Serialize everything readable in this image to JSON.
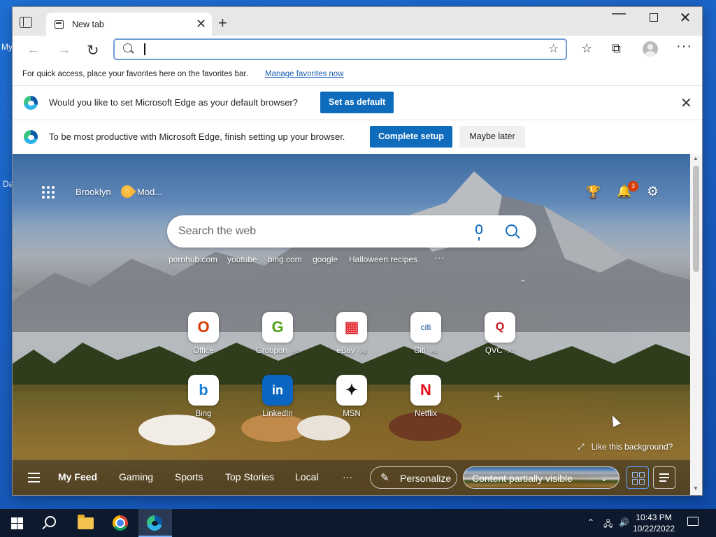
{
  "desktop": {
    "fragment1": "My",
    "fragment2": "Da"
  },
  "browser": {
    "tab_title": "New tab",
    "tab_close": "✕",
    "new_tab_symbol": "+",
    "address_value": "",
    "favbar_text": "For quick access, place your favorites here on the favorites bar.",
    "favbar_link": "Manage favorites now"
  },
  "infobars": {
    "default_prompt": "Would you like to set Microsoft Edge as your default browser?",
    "set_default_label": "Set as default",
    "setup_prompt": "To be most productive with Microsoft Edge, finish setting up your browser.",
    "complete_setup_label": "Complete setup",
    "maybe_later_label": "Maybe later"
  },
  "ntp": {
    "location": "Brooklyn",
    "weather": "Mod...",
    "notification_count": "3",
    "search_placeholder": "Search the web",
    "quick_links": [
      "pornhub.com",
      "youtube",
      "bing.com",
      "google",
      "Halloween recipes"
    ],
    "tiles": [
      {
        "label": "Office",
        "ad": "",
        "glyph": "O",
        "color": "#d83b01"
      },
      {
        "label": "Groupon",
        "ad": "· Ad",
        "glyph": "G",
        "color": "#53a318"
      },
      {
        "label": "eBay",
        "ad": "· Ad",
        "glyph": "▦",
        "color": "#e53238"
      },
      {
        "label": "Citi",
        "ad": "· Ad",
        "glyph": "citi",
        "color": "#1a4b9c"
      },
      {
        "label": "QVC",
        "ad": "· Ad",
        "glyph": "Q",
        "color": "#c4161c"
      },
      {
        "label": "Bing",
        "ad": "",
        "glyph": "b",
        "color": "#1a7fd9"
      },
      {
        "label": "LinkedIn",
        "ad": "",
        "glyph": "in",
        "color": "#0a66c2"
      },
      {
        "label": "MSN",
        "ad": "",
        "glyph": "✦",
        "color": "#111111"
      },
      {
        "label": "Netflix",
        "ad": "",
        "glyph": "N",
        "color": "#e50914"
      }
    ],
    "like_background": "Like this background?",
    "feed": {
      "my_feed": "My Feed",
      "items": [
        "Gaming",
        "Sports",
        "Top Stories",
        "Local"
      ],
      "more": "···",
      "personalize": "Personalize",
      "content_visibility": "Content partially visible"
    }
  },
  "taskbar": {
    "time": "10:43 PM",
    "date": "10/22/2022"
  },
  "colors": {
    "accent": "#0f6cbd",
    "badge": "#d83b01",
    "taskbar": "#0d1a2e"
  }
}
